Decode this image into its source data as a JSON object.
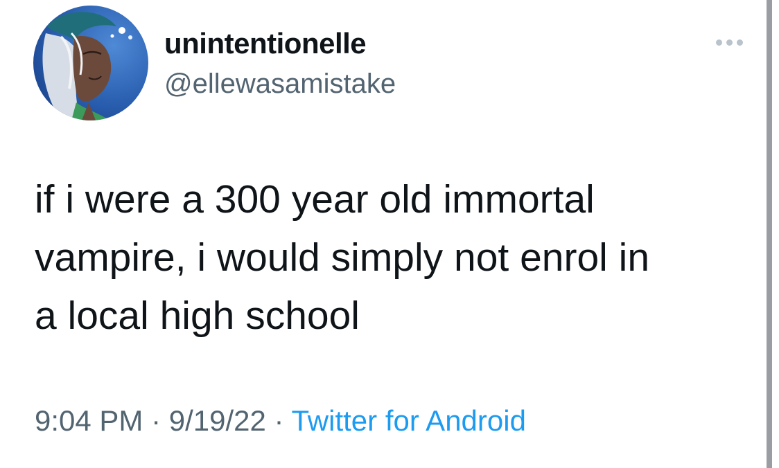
{
  "tweet": {
    "author": {
      "display_name": "unintentionelle",
      "handle": "@ellewasamistake",
      "avatar": "avatar-illustration"
    },
    "more_icon": "more-horizontal-icon",
    "text_lines": [
      "if i were a 300 year old immortal",
      "vampire, i would simply not enrol in",
      "a local high school"
    ],
    "time": "9:04 PM",
    "separator": " · ",
    "date": "9/19/22",
    "source": "Twitter for Android"
  },
  "colors": {
    "text_primary": "#0f1419",
    "text_secondary": "#536471",
    "link": "#1d9bf0",
    "background": "#ffffff"
  }
}
